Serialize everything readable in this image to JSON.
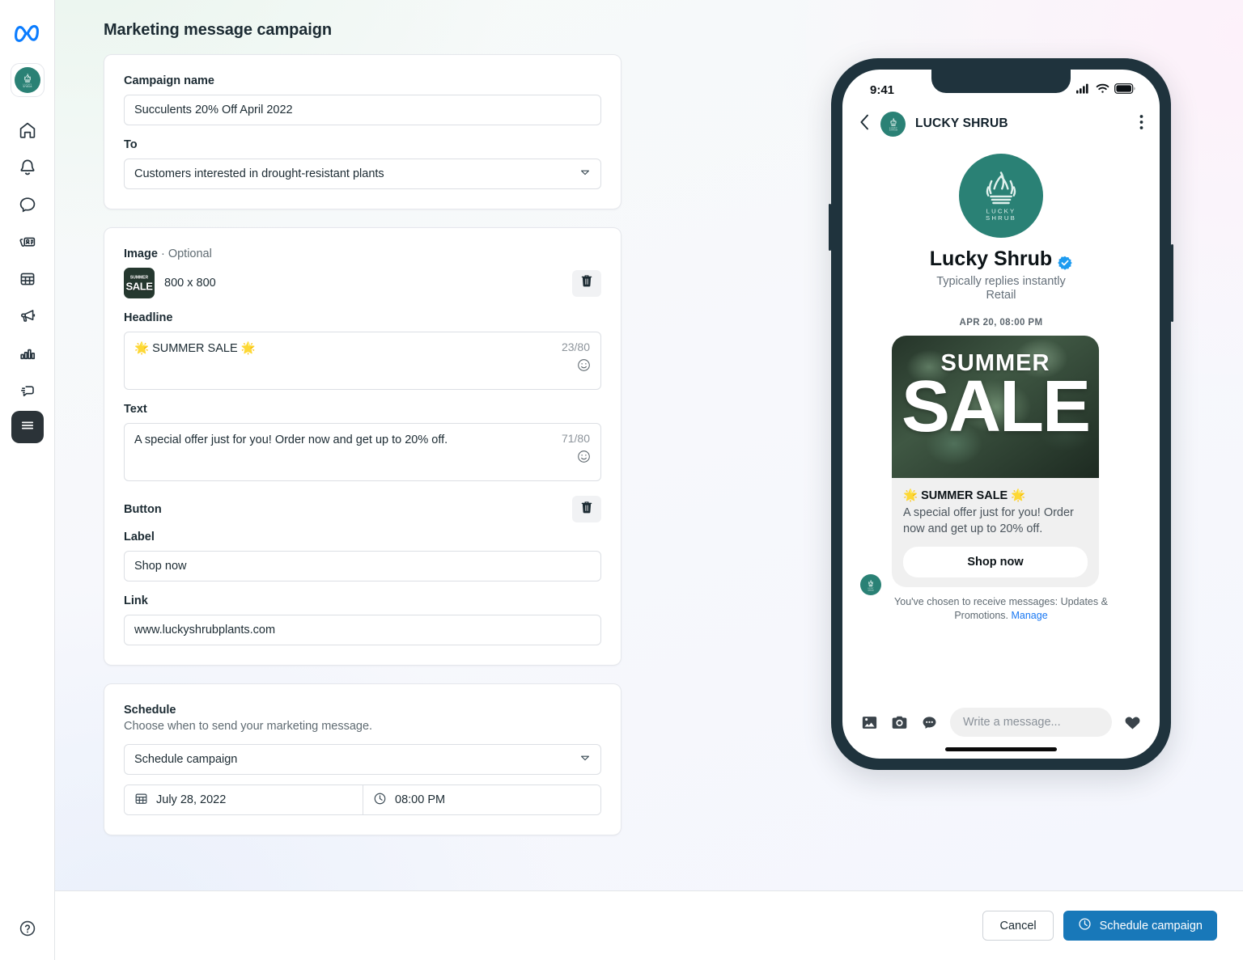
{
  "rail": {
    "logo": "meta-logo",
    "business_avatar_alt": "LUCKY SHRUB",
    "items": [
      {
        "icon": "home-icon",
        "name": "home"
      },
      {
        "icon": "bell-icon",
        "name": "notifications"
      },
      {
        "icon": "chat-bubble-icon",
        "name": "inbox"
      },
      {
        "icon": "cards-icon",
        "name": "contacts"
      },
      {
        "icon": "calculator-icon",
        "name": "catalog"
      },
      {
        "icon": "megaphone-icon",
        "name": "ads"
      },
      {
        "icon": "bar-chart-icon",
        "name": "insights"
      },
      {
        "icon": "speech-reply-icon",
        "name": "messages"
      },
      {
        "icon": "hamburger-icon",
        "name": "more",
        "active": true
      }
    ],
    "help": "help-icon"
  },
  "page": {
    "title": "Marketing message campaign"
  },
  "campaign_card": {
    "name_label": "Campaign name",
    "name_value": "Succulents 20% Off April 2022",
    "to_label": "To",
    "to_value": "Customers interested in drought-resistant plants"
  },
  "content_card": {
    "image_label": "Image",
    "image_separator": "·",
    "image_optional": "Optional",
    "image_dimensions": "800 x 800",
    "image_thumb_text": "SALE",
    "image_thumb_subtext": "SUMMER",
    "delete_image_icon": "trash-icon",
    "headline_label": "Headline",
    "headline_value": "🌟 SUMMER SALE 🌟",
    "headline_counter": "23/80",
    "headline_emoji_icon": "emoji-icon",
    "text_label": "Text",
    "text_value": "A special offer just for you! Order now and get up to 20% off.",
    "text_counter": "71/80",
    "text_emoji_icon": "emoji-icon",
    "button_label": "Button",
    "delete_button_icon": "trash-icon",
    "label_label": "Label",
    "label_value": "Shop now",
    "link_label": "Link",
    "link_value": "www.luckyshrubplants.com"
  },
  "schedule_card": {
    "title": "Schedule",
    "description": "Choose when to send your marketing message.",
    "select_value": "Schedule campaign",
    "date_value": "July 28, 2022",
    "date_icon": "calendar-icon",
    "time_value": "08:00 PM",
    "time_icon": "clock-icon"
  },
  "preview": {
    "status_time": "9:41",
    "status_icons": [
      "signal-icon",
      "wifi-icon",
      "battery-icon"
    ],
    "back_icon": "chevron-left-icon",
    "header_name": "LUCKY SHRUB",
    "kebab_icon": "kebab-menu-icon",
    "avatar_name_line1": "LUCKY",
    "avatar_name_line2": "SHRUB",
    "business_name": "Lucky Shrub",
    "verified_icon": "verified-badge-icon",
    "typically_replies": "Typically replies instantly",
    "category": "Retail",
    "message_timestamp": "APR 20, 08:00 PM",
    "image_top_text": "SUMMER",
    "image_big_text": "SALE",
    "bubble_headline": "🌟 SUMMER SALE 🌟",
    "bubble_text": "A special offer just for you! Order now and get up to 20% off.",
    "bubble_cta": "Shop now",
    "optin_text": "You've chosen to receive messages: Updates & Promotions. ",
    "optin_link": "Manage",
    "composer_icons": [
      "photo-icon",
      "camera-icon",
      "sticker-icon"
    ],
    "composer_placeholder": "Write a message...",
    "like_icon": "heart-icon"
  },
  "footer": {
    "cancel_label": "Cancel",
    "primary_label": "Schedule campaign",
    "primary_icon": "clock-icon",
    "primary_color": "#1878b9"
  }
}
